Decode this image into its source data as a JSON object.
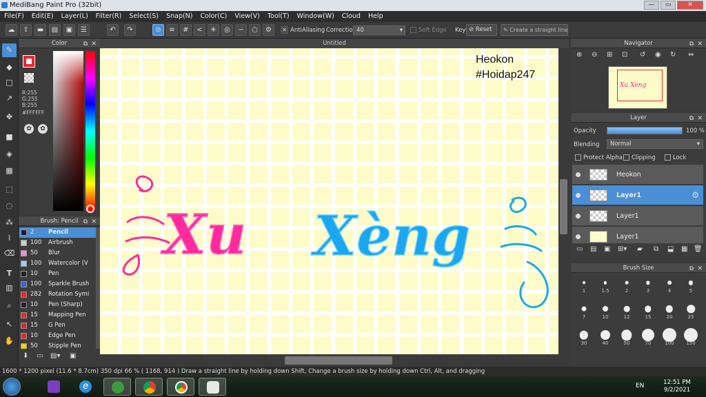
{
  "window": {
    "title": "MediBang Paint Pro (32bit)"
  },
  "menu": [
    "File(F)",
    "Edit(E)",
    "Layer(L)",
    "Filter(R)",
    "Select(S)",
    "Snap(N)",
    "Color(C)",
    "View(V)",
    "Tool(T)",
    "Window(W)",
    "Cloud",
    "Help"
  ],
  "toolbar": {
    "antialiasing": "AntiAliasing",
    "correction_label": "Correction",
    "correction_value": "40",
    "soft_edge": "Soft Edge",
    "key_label": "Key",
    "reset": "Reset",
    "straight_line": "Create a straight line"
  },
  "color_panel": {
    "title": "Color",
    "r": "R:255",
    "g": "G:255",
    "b": "B:255",
    "hex": "#FFFFFF",
    "colors": {
      "primary": "#e8262b",
      "secondary": "#ffffff"
    }
  },
  "brush_panel": {
    "title": "Brush: Pencil",
    "items": [
      {
        "size": "2",
        "name": "Pencil",
        "color": "#1a1a3a"
      },
      {
        "size": "100",
        "name": "Airbrush",
        "color": "#cccccc"
      },
      {
        "size": "50",
        "name": "Blur",
        "color": "#f08bd8"
      },
      {
        "size": "100",
        "name": "Watercolor (V",
        "color": "#8fd4f5"
      },
      {
        "size": "10",
        "name": "Pen",
        "color": "#222222"
      },
      {
        "size": "100",
        "name": "Sparkle Brush",
        "color": "#3c5fd8"
      },
      {
        "size": "282",
        "name": "Rotation Symi",
        "color": "#e8262b"
      },
      {
        "size": "10",
        "name": "Pen (Sharp)",
        "color": "#222222"
      },
      {
        "size": "15",
        "name": "Mapping Pen",
        "color": "#e8262b"
      },
      {
        "size": "15",
        "name": "G Pen",
        "color": "#e8262b"
      },
      {
        "size": "10",
        "name": "Edge Pen",
        "color": "#e8262b"
      },
      {
        "size": "50",
        "name": "Stipple Pen",
        "color": "#f0d000"
      }
    ]
  },
  "canvas": {
    "tab": "Untitled",
    "watermark_line1": "Heokon",
    "watermark_line2": "#Hoidap247",
    "art_left": "Xu",
    "art_right": "Xèng",
    "colors": {
      "paper": "#fdfcc8",
      "left": "#ff2a9d",
      "right": "#1aa7f0"
    }
  },
  "navigator": {
    "title": "Navigator",
    "thumb_text": "Xu Xèng"
  },
  "layer_panel": {
    "title": "Layer",
    "opacity_label": "Opacity",
    "opacity_value": "100 %",
    "opacity": 1.0,
    "blending_label": "Blending",
    "blending_value": "Normal",
    "protect_alpha": "Protect Alpha",
    "clipping": "Clipping",
    "lock": "Lock",
    "layers": [
      {
        "name": "Heokon",
        "selected": false
      },
      {
        "name": "Layer1",
        "selected": true
      },
      {
        "name": "Layer1",
        "selected": false
      },
      {
        "name": "Layer1",
        "selected": false
      }
    ]
  },
  "brush_size": {
    "title": "Brush Size",
    "sizes": [
      "1",
      "1.5",
      "2",
      "3",
      "4",
      "5",
      "7",
      "10",
      "12",
      "15",
      "20",
      "25",
      "30",
      "40",
      "50",
      "70",
      "100",
      "150"
    ]
  },
  "status": {
    "text": "1600 * 1200 pixel   (11.6 * 8.7cm)   350 dpi   66 %   ( 1168, 914 )   Draw a straight line by holding down Shift, Change a brush size by holding down Ctrl, Alt, and dragging"
  },
  "taskbar": {
    "lang": "EN",
    "time": "12:51 PM",
    "date": "9/2/2021"
  }
}
